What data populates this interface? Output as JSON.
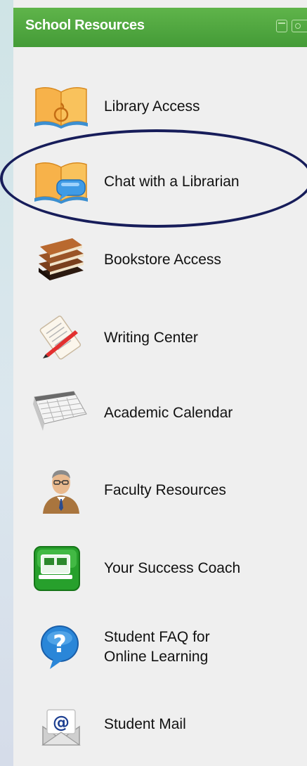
{
  "widget": {
    "title": "School Resources",
    "header_icons": [
      "minimize-icon",
      "settings-icon"
    ],
    "colors": {
      "header": "#4ba53c",
      "highlight_ring": "#171d5a",
      "panel_bg": "#efefef"
    }
  },
  "items": [
    {
      "label": "Library Access",
      "icon": "open-book-icon"
    },
    {
      "label": "Chat with a Librarian",
      "icon": "book-chat-icon",
      "highlighted": true
    },
    {
      "label": "Bookstore Access",
      "icon": "book-stack-icon"
    },
    {
      "label": "Writing Center",
      "icon": "notepad-pencil-icon"
    },
    {
      "label": "Academic Calendar",
      "icon": "calendar-icon"
    },
    {
      "label": "Faculty Resources",
      "icon": "professor-icon"
    },
    {
      "label": "Your Success Coach",
      "icon": "coach-screen-icon"
    },
    {
      "label_line1": "Student FAQ for",
      "label_line2": "Online Learning",
      "icon": "question-bubble-icon"
    },
    {
      "label": "Student Mail",
      "icon": "mail-envelope-icon"
    }
  ]
}
